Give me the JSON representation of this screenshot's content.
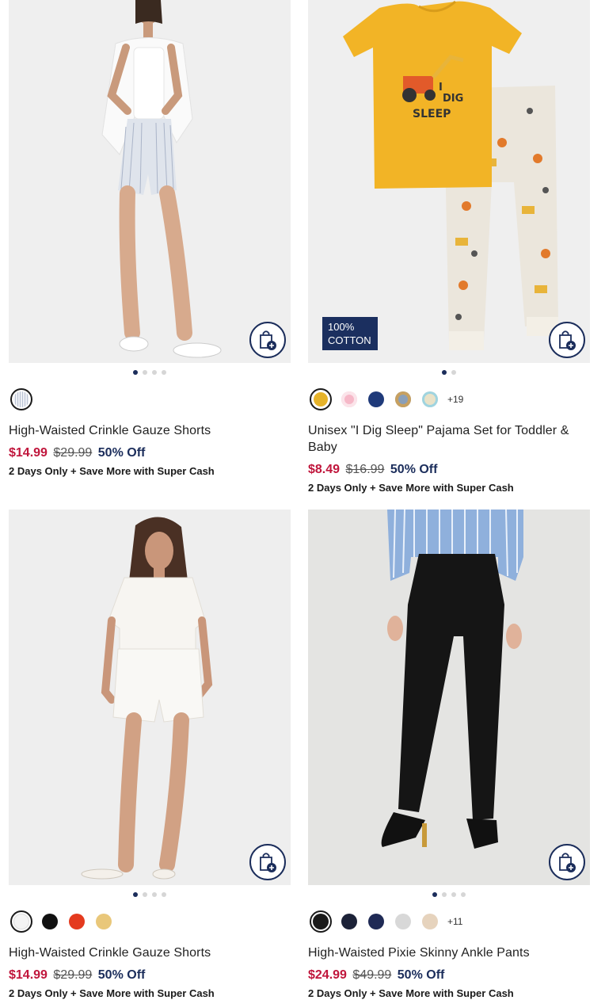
{
  "products": [
    {
      "title": "High-Waisted Crinkle Gauze Shorts",
      "sale_price": "$14.99",
      "original_price": "$29.99",
      "discount": "50% Off",
      "promo": "2 Days Only + Save More with Super Cash",
      "image_dots": 4,
      "swatches": [
        "#f2f4f8"
      ],
      "more_swatches": ""
    },
    {
      "title": "Unisex \"I Dig Sleep\" Pajama Set for Toddler & Baby",
      "sale_price": "$8.49",
      "original_price": "$16.99",
      "discount": "50% Off",
      "promo": "2 Days Only + Save More with Super Cash",
      "badge": "100% COTTON",
      "image_dots": 2,
      "swatches": [
        "#e6b32a",
        "#f6b8c8",
        "#1f3a7a",
        "#8a9fb8",
        "#e9e2c8"
      ],
      "more_swatches": "+19"
    },
    {
      "title": "High-Waisted Crinkle Gauze Shorts",
      "sale_price": "$14.99",
      "original_price": "$29.99",
      "discount": "50% Off",
      "promo": "2 Days Only + Save More with Super Cash",
      "image_dots": 4,
      "swatches": [
        "#f4f4f4",
        "#111111",
        "#e43a1e",
        "#e9c77a"
      ],
      "more_swatches": ""
    },
    {
      "title": "High-Waisted Pixie Skinny Ankle Pants",
      "sale_price": "$24.99",
      "original_price": "$49.99",
      "discount": "50% Off",
      "promo": "2 Days Only + Save More with Super Cash",
      "image_dots": 4,
      "swatches": [
        "#1a1a1a",
        "#1c2238",
        "#1f2a55",
        "#d8d8d8",
        "#e6d3bd"
      ],
      "more_swatches": "+11"
    }
  ],
  "colors": {
    "sale": "#c0163c",
    "discount": "#1b2d5b",
    "accent": "#1b2d5b"
  },
  "icons": {
    "bag_button": "shopping-bag-plus-icon"
  }
}
